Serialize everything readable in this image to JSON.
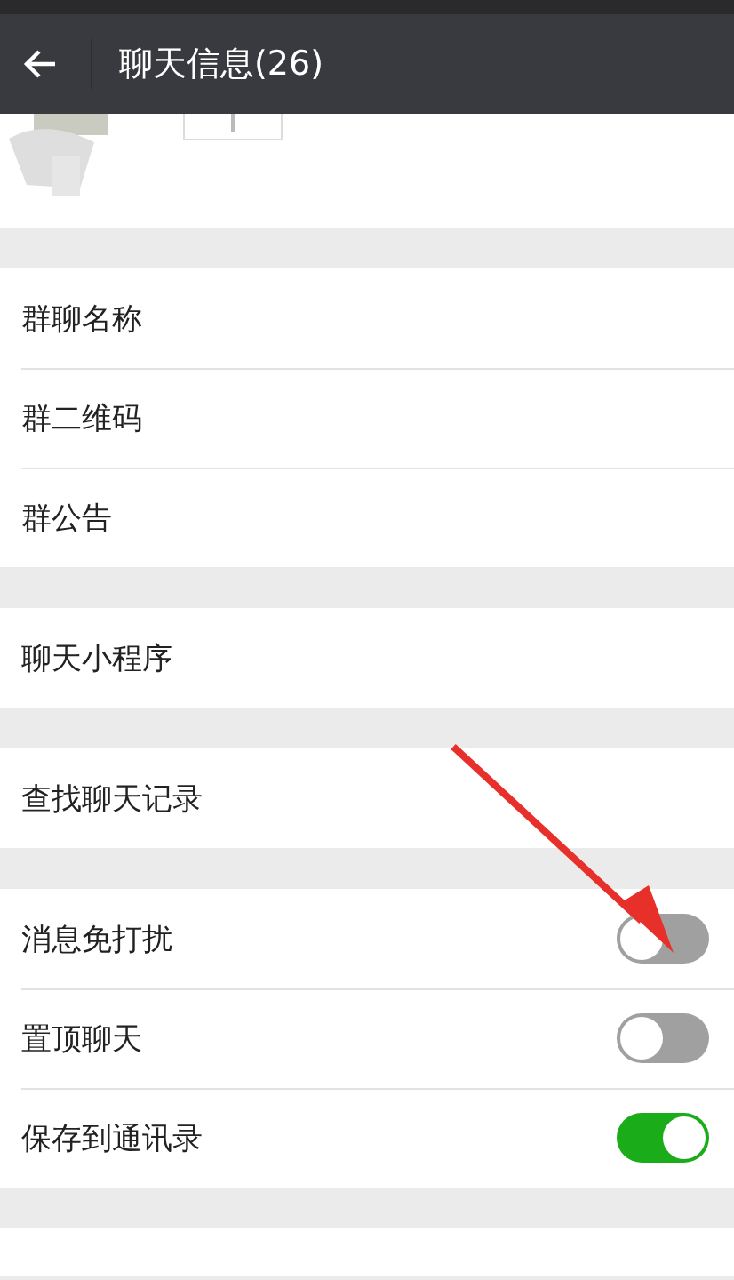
{
  "header": {
    "title": "聊天信息(26)"
  },
  "groups": [
    {
      "rows": [
        {
          "label": "群聊名称",
          "kind": "link"
        },
        {
          "label": "群二维码",
          "kind": "link"
        },
        {
          "label": "群公告",
          "kind": "link"
        }
      ]
    },
    {
      "rows": [
        {
          "label": "聊天小程序",
          "kind": "link"
        }
      ]
    },
    {
      "rows": [
        {
          "label": "查找聊天记录",
          "kind": "link"
        }
      ]
    },
    {
      "rows": [
        {
          "label": "消息免打扰",
          "kind": "toggle",
          "on": false
        },
        {
          "label": "置顶聊天",
          "kind": "toggle",
          "on": false
        },
        {
          "label": "保存到通讯录",
          "kind": "toggle",
          "on": true
        }
      ]
    }
  ]
}
